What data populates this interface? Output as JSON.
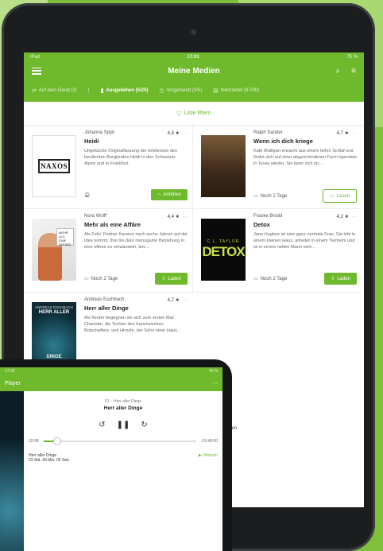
{
  "tablet": {
    "status": {
      "left": "iPad",
      "time": "17:01",
      "right": "75 %"
    },
    "title": "Meine Medien",
    "tabs": [
      {
        "label": "Auf dem Gerät (2)",
        "active": false
      },
      {
        "label": "Ausgeliehen (5/25)",
        "active": true
      },
      {
        "label": "Vorgemerkt (0/5)",
        "active": false
      },
      {
        "label": "Merkzettel (97/90)",
        "active": false
      }
    ],
    "filter_label": "Liste filtern",
    "books": [
      {
        "author": "Johanna Spyri",
        "rating": "4,5 ★",
        "title": "Heidi",
        "desc": "Ungekürzte Originalfassung der Erlebnisse des berühmten Bergkindes Heidi in den Schweizer Alpen und in Frankfurt.",
        "due": "",
        "action": "Anhören",
        "cover_text": "NAXOS"
      },
      {
        "author": "Ralph Sander",
        "rating": "4,7 ★",
        "title": "Wenn ich dich kriege",
        "desc": "Kate Mulligan erwacht aus einem tiefen Schlaf und findet sich auf einer abgeschiedenen Farm irgendwo in Texas wieder. Sie kann sich nic...",
        "due": "Noch 2 Tage",
        "action": "Lesen",
        "cover_text": ""
      },
      {
        "author": "Nora Wolff",
        "rating": "4,4 ★",
        "title": "Mehr als eine Affäre",
        "desc": "Als Felix' Partner Karsten nach sechs Jahren auf die Idee kommt, ihre bis dato monogame Beziehung in eine offene zu verwandeln, bric...",
        "due": "Noch 2 Tage",
        "action": "Laden",
        "cover_text": "MEHR ALS EINE AFFÄRE"
      },
      {
        "author": "Frauke Brodd",
        "rating": "4,2 ★",
        "title": "Detox",
        "desc": "Jane Hughes ist eine ganz normale Frau. Sie lebt in einem kleinen Haus, arbeitet in einem Tierheim und ist in einem netten Mann verli...",
        "due": "Noch 2 Tage",
        "action": "Laden",
        "cover_text": "DETOX",
        "cover_author": "C.L. TAYLOR"
      },
      {
        "author": "Andreas Eschbach",
        "rating": "4,7 ★",
        "title": "Herr aller Dinge",
        "desc": "Als Kinder begegnen sie sich zum ersten Mal: Charlotte, die Tochter des französischen Botschafters, und Hiroshi, der Sohn einer Haus...",
        "due": "",
        "action": "",
        "cover_text": "DINGE",
        "cover_author": "ANDREAS ESCHBACH",
        "cover_sub": "HERR ALLER"
      }
    ],
    "partial_text": "gen"
  },
  "phone": {
    "status": {
      "time": "17:02",
      "right": "76 %"
    },
    "title": "Player",
    "track_sub": "01 – Herr aller Dinge",
    "track_title": "Herr aller Dinge",
    "time_elapsed": "02:08",
    "time_remaining": "-23:49:00",
    "chapter_title": "Herr aller Dinge",
    "chapter_meta": "23 Std. 40 Min. 05 Sek.",
    "chapter_status": "▶ Hörbuch",
    "progress": 0.09
  },
  "colors": {
    "accent": "#6fba2c",
    "background": "#7fbf3a"
  }
}
